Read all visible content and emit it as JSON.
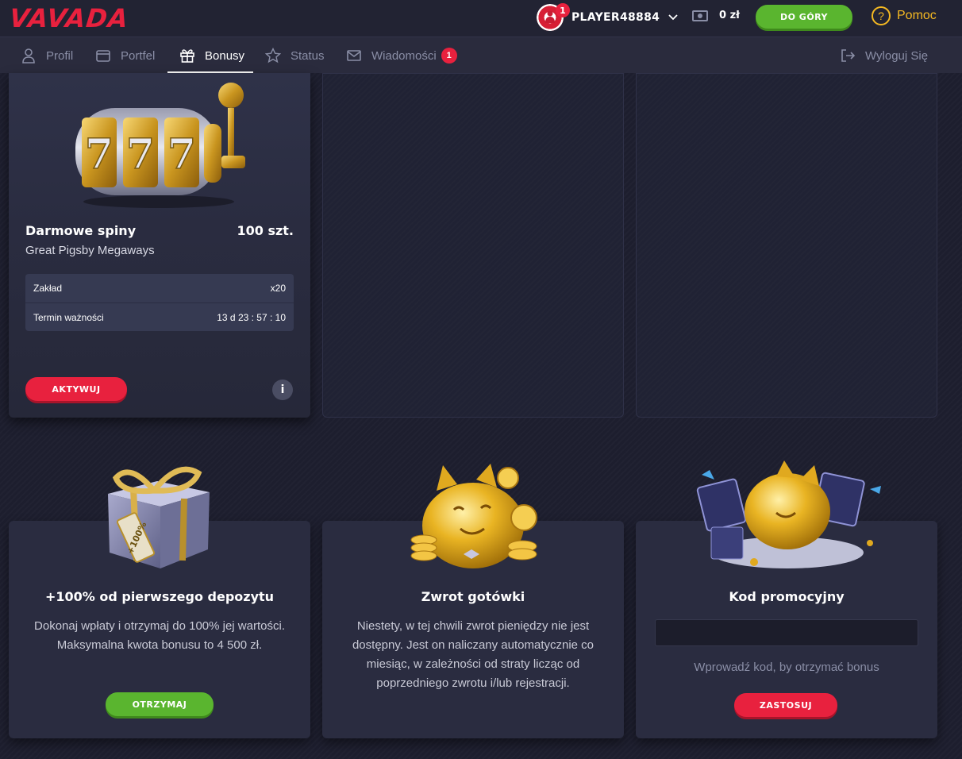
{
  "header": {
    "logo": "VAVADA",
    "username": "PLAYER48884",
    "notification_count": "1",
    "balance": "0 zł",
    "top_button": "DO GÓRY",
    "help": "Pomoc"
  },
  "nav": {
    "items": [
      {
        "label": "Profil",
        "icon": "user-icon"
      },
      {
        "label": "Portfel",
        "icon": "wallet-icon"
      },
      {
        "label": "Bonusy",
        "icon": "gift-icon",
        "active": true
      },
      {
        "label": "Status",
        "icon": "star-icon"
      },
      {
        "label": "Wiadomości",
        "icon": "mail-icon",
        "badge": "1"
      }
    ],
    "logout": "Wyloguj Się"
  },
  "free_spins": {
    "title": "Darmowe spiny",
    "count": "100 szt.",
    "game": "Great Pigsby Megaways",
    "details": [
      {
        "label": "Zakład",
        "value": "x20"
      },
      {
        "label": "Termin ważności",
        "value": "13 d 23 : 57 : 10"
      }
    ],
    "activate": "AKTYWUJ",
    "info": "i"
  },
  "offers": [
    {
      "title": "+100% od pierwszego depozytu",
      "desc": "Dokonaj wpłaty i otrzymaj do 100% jej wartości. Maksymalna kwota bonusu to 4 500 zł.",
      "button": "OTRZYMAJ",
      "gift_tag": "+100%"
    },
    {
      "title": "Zwrot gotówki",
      "desc": "Niestety, w tej chwili zwrot pieniędzy nie jest dostępny. Jest on naliczany automatycznie co miesiąc, w zależności od straty licząc od poprzedniego zwrotu i/lub rejestracji."
    },
    {
      "title": "Kod promocyjny",
      "input_value": "",
      "hint": "Wprowadź kod, by otrzymać bonus",
      "button": "ZASTOSUJ"
    }
  ],
  "colors": {
    "accent_red": "#e8213e",
    "accent_green": "#5ab52f",
    "help_gold": "#f5b922",
    "background": "#1d1e2e"
  }
}
